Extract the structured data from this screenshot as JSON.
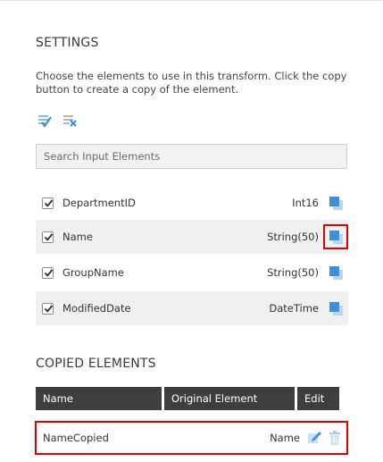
{
  "settings": {
    "title": "SETTINGS",
    "description": "Choose the elements to use in this transform. Click the copy button to create a copy of the element.",
    "search_placeholder": "Search Input Elements"
  },
  "elements": [
    {
      "name": "DepartmentID",
      "type": "Int16",
      "checked": true
    },
    {
      "name": "Name",
      "type": "String(50)",
      "checked": true,
      "highlighted": true
    },
    {
      "name": "GroupName",
      "type": "String(50)",
      "checked": true
    },
    {
      "name": "ModifiedDate",
      "type": "DateTime",
      "checked": true
    }
  ],
  "copied": {
    "title": "COPIED ELEMENTS",
    "headers": {
      "name": "Name",
      "original": "Original Element",
      "edit": "Edit"
    },
    "rows": [
      {
        "name": "NameCopied",
        "original": "Name"
      }
    ]
  },
  "colors": {
    "accent_blue": "#3d8fd8",
    "highlight_red": "#e00000",
    "header_dark": "#3e3e3e"
  },
  "icons": [
    "select-all-icon",
    "clear-all-icon",
    "copy-icon",
    "edit-icon",
    "delete-icon",
    "checkmark-icon"
  ]
}
